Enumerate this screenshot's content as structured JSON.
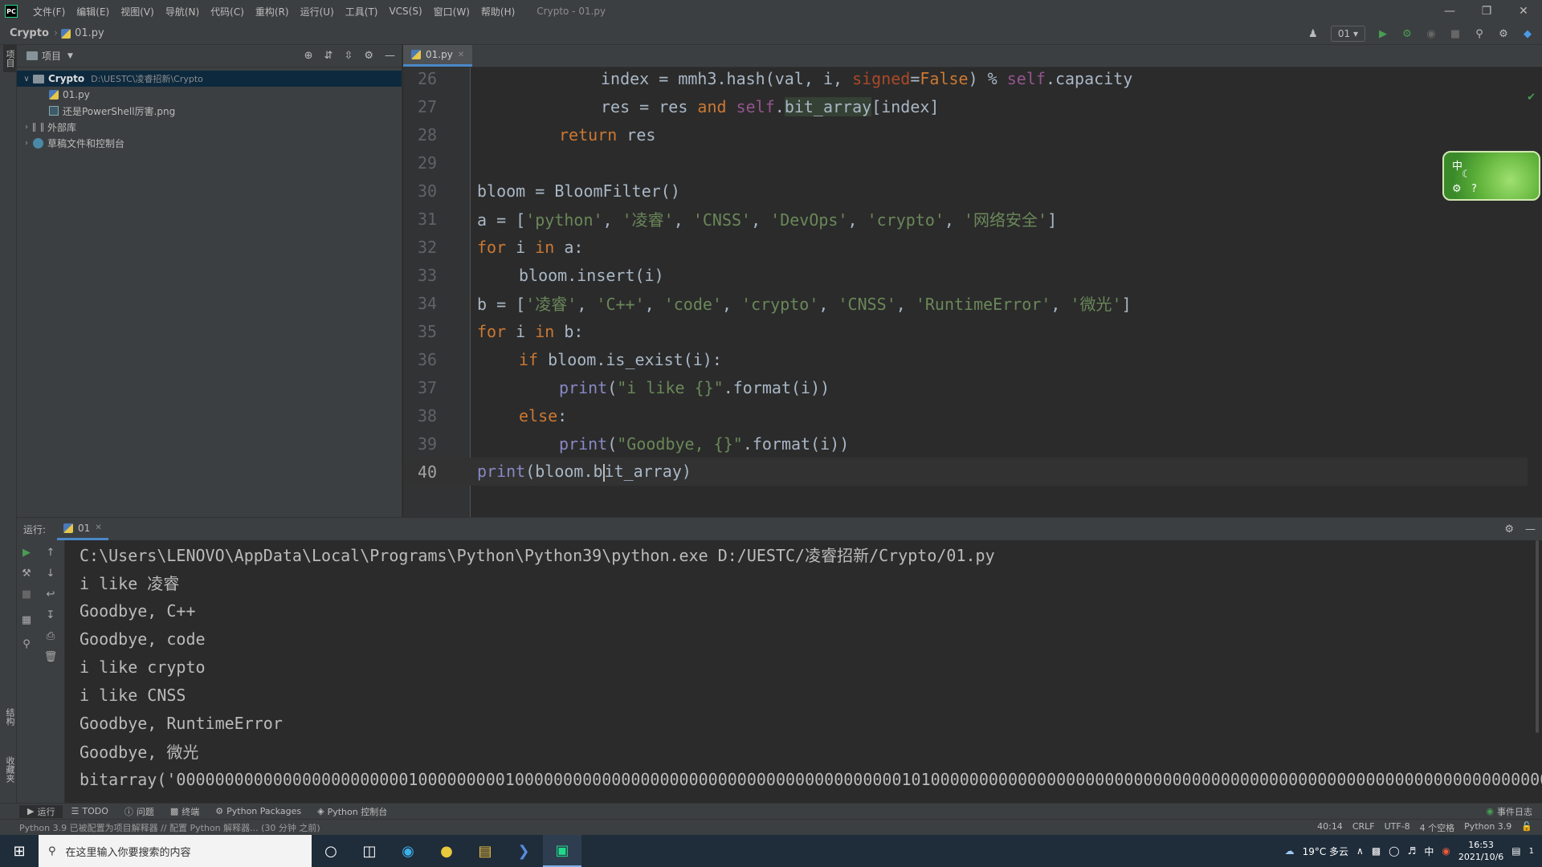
{
  "titlebar": {
    "logo": "PC",
    "menu": [
      "文件(F)",
      "编辑(E)",
      "视图(V)",
      "导航(N)",
      "代码(C)",
      "重构(R)",
      "运行(U)",
      "工具(T)",
      "VCS(S)",
      "窗口(W)",
      "帮助(H)"
    ],
    "window_title": "Crypto - 01.py"
  },
  "navbar": {
    "project": "Crypto",
    "file": "01.py",
    "run_config": "01"
  },
  "left_strip": {
    "top_label": "项目",
    "bottom_label_1": "结构",
    "bottom_label_2": "收藏夹"
  },
  "project_panel": {
    "title": "项目",
    "tree": [
      {
        "name": "Crypto",
        "path": "D:\\UESTC\\凌睿招新\\Crypto"
      },
      {
        "name": "01.py"
      },
      {
        "name": "还是PowerShell厉害.png"
      },
      {
        "name": "外部库"
      },
      {
        "name": "草稿文件和控制台"
      }
    ]
  },
  "editor": {
    "tab": "01.py",
    "line_numbers": [
      "26",
      "27",
      "28",
      "29",
      "30",
      "31",
      "32",
      "33",
      "34",
      "35",
      "36",
      "37",
      "38",
      "39",
      "40"
    ],
    "current_line": "40"
  },
  "ime": {
    "char": "中",
    "help": "?"
  },
  "run_panel": {
    "label": "运行:",
    "tab": "01",
    "console": [
      "C:\\Users\\LENOVO\\AppData\\Local\\Programs\\Python\\Python39\\python.exe D:/UESTC/凌睿招新/Crypto/01.py",
      "i like 凌睿",
      "Goodbye, C++",
      "Goodbye, code",
      "i like crypto",
      "i like CNSS",
      "Goodbye, RuntimeError",
      "Goodbye, 微光",
      "bitarray('000000000000000000000000100000000010000000000000000000000000000000000000000101000000000000000000000000000000000000000000000000000000000000000000"
    ]
  },
  "bottom_tabs": {
    "run": "运行",
    "todo": "TODO",
    "problems": "问题",
    "terminal": "终端",
    "packages": "Python Packages",
    "console": "Python 控制台",
    "event_log": "事件日志"
  },
  "status": {
    "message": "Python 3.9 已被配置为项目解释器 // 配置 Python 解释器... (30 分钟 之前)",
    "position": "40:14",
    "line_sep": "CRLF",
    "encoding": "UTF-8",
    "indent": "4 个空格",
    "interpreter": "Python 3.9"
  },
  "taskbar": {
    "search_placeholder": "在这里输入你要搜索的内容",
    "weather": "19°C 多云",
    "time": "16:53",
    "date": "2021/10/6",
    "notifications": "1"
  },
  "colors": {
    "bg": "#2b2b2b",
    "panel": "#3c3f41",
    "keyword": "#cc7832",
    "string": "#6a8759",
    "self": "#94558d",
    "accent": "#4a88c7"
  }
}
